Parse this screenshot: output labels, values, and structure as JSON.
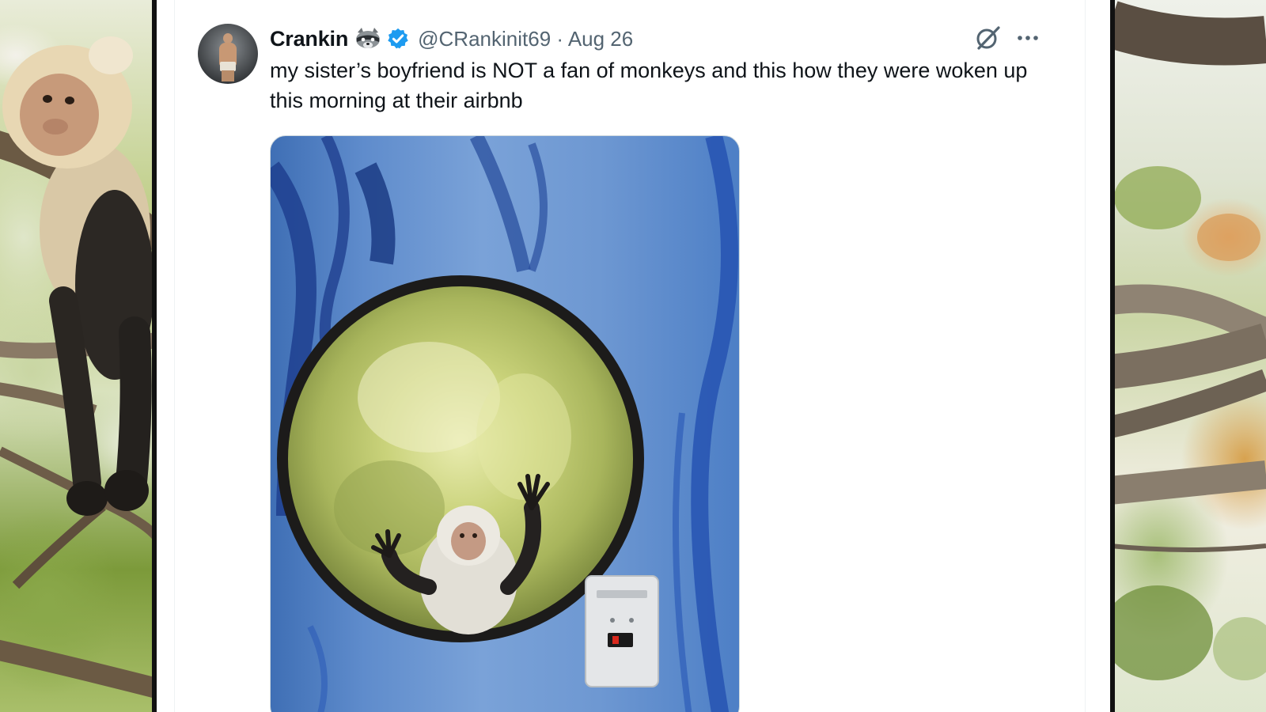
{
  "tweet": {
    "display_name": "Crankin",
    "handle": "@CRankinit69",
    "date": "Aug 26",
    "handle_date": "@CRankinit69 · Aug 26",
    "text": "my sister’s boyfriend is NOT a fan of monkeys and this how they were woken up this morning at their airbnb",
    "verified": true,
    "name_emoji": "raccoon-icon"
  },
  "icons": {
    "verified": "verified-badge-icon",
    "grok": "grok-icon",
    "more": "more-options-icon"
  },
  "colors": {
    "name_text": "#0f1419",
    "secondary_text": "#536471",
    "verified_blue": "#1d9bf0",
    "card_border": "#eff3f4"
  }
}
